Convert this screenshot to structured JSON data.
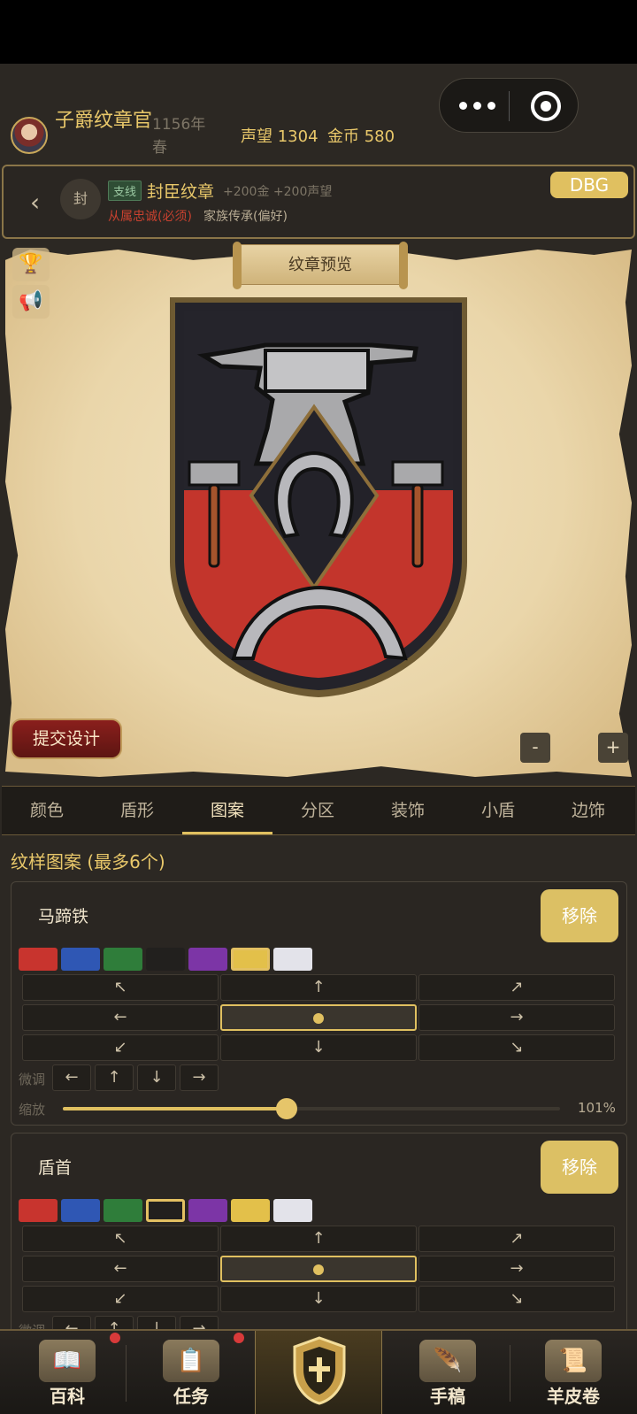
{
  "header": {
    "player_title": "子爵纹章官",
    "date": "1156年春",
    "prestige": "声望 1304",
    "gold": "金币 580"
  },
  "quest": {
    "seal": "封",
    "tag": "支线",
    "title": "封臣纹章",
    "reward": "+200金 +200声望",
    "requirement_required": "从属忠诚(必须)",
    "requirement_preferred": "家族传承(偏好)",
    "debug_label": "DBG"
  },
  "preview": {
    "banner": "纹章预览",
    "submit": "提交设计",
    "zoom_out": "-",
    "zoom_in": "+"
  },
  "tabs": [
    "颜色",
    "盾形",
    "图案",
    "分区",
    "装饰",
    "小盾",
    "边饰"
  ],
  "active_tab": "图案",
  "section_title": "纹样图案 (最多6个)",
  "palette": [
    "#c8342e",
    "#2f57b4",
    "#2f7d3a",
    "#22201e",
    "#7c35a6",
    "#e3c04a",
    "#e3e3ea"
  ],
  "direction_arrows": [
    "↖",
    "↑",
    "↗",
    "←",
    "●",
    "→",
    "↙",
    "↓",
    "↘"
  ],
  "fine_tune": {
    "label": "微调",
    "buttons": [
      "←",
      "↑",
      "↓",
      "→"
    ]
  },
  "charges": [
    {
      "name": "马蹄铁",
      "remove": "移除",
      "selected_color_index": 5,
      "scale_label": "缩放",
      "scale_value": "101%",
      "scale_fraction": 0.45
    },
    {
      "name": "盾首",
      "remove": "移除",
      "selected_color_index": 3
    }
  ],
  "nav": {
    "items": [
      "百科",
      "任务",
      "手稿",
      "羊皮卷"
    ],
    "icons": [
      "book-icon",
      "scroll-list-icon",
      "feather-icon",
      "parchment-scroll-icon"
    ],
    "center_icon": "shield-crest-icon"
  }
}
